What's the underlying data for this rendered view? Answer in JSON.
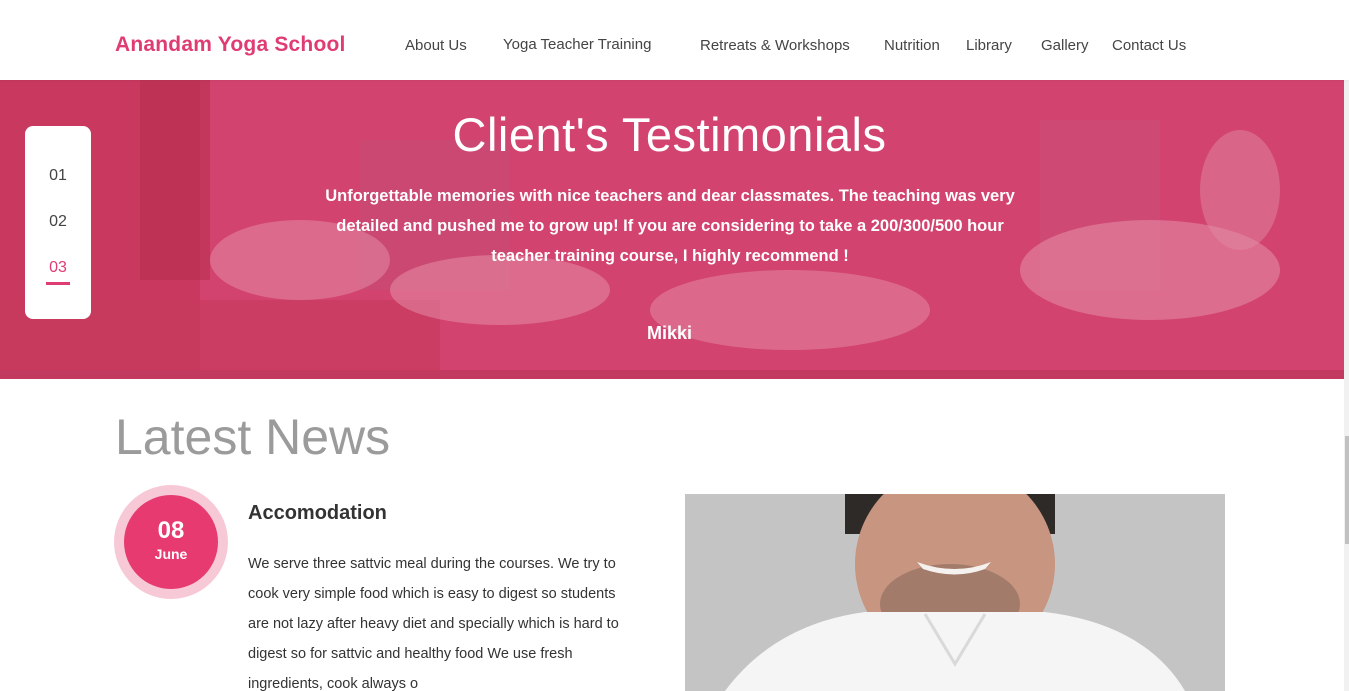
{
  "header": {
    "brand": "Anandam Yoga School",
    "nav": [
      "About Us",
      "Yoga Teacher Training",
      "Retreats & Workshops",
      "Nutrition",
      "Library",
      "Gallery",
      "Contact Us"
    ]
  },
  "testimonials": {
    "title": "Client's Testimonials",
    "quote": "Unforgettable memories with nice teachers and dear classmates. The teaching was very detailed and pushed me to grow up! If you are considering to take a 200/300/500 hour teacher training course, I highly recommend !",
    "author": "Mikki",
    "pager": [
      "01",
      "02",
      "03"
    ],
    "active_index": 2
  },
  "news": {
    "heading": "Latest News",
    "post": {
      "day": "08",
      "month": "June",
      "title": "Accomodation",
      "body": "We serve three sattvic meal during the courses. We try to cook very simple food which is easy to digest so students are not lazy after heavy diet and specially which is hard to digest so for sattvic and healthy food We use fresh ingredients, cook always o"
    }
  },
  "colors": {
    "brand": "#e03c74",
    "hero_overlay": "#d43e6e",
    "date_badge": "#e63a71"
  }
}
